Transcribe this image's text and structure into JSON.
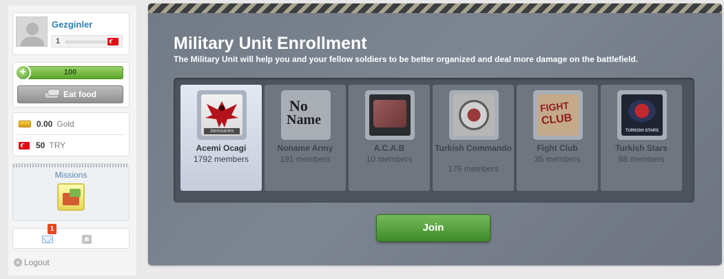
{
  "sidebar": {
    "username": "Gezginler",
    "level": "1",
    "health_value": "100",
    "eat_food_label": "Eat food",
    "gold_amount": "0.00",
    "gold_label": "Gold",
    "try_amount": "50",
    "try_label": "TRY",
    "missions_label": "Missions",
    "messages_badge": "1",
    "logout_label": "Logout"
  },
  "main": {
    "title": "Military Unit Enrollment",
    "subtitle": "The Military Unit will help you and your fellow soldiers to be better organized and deal more damage on the battlefield.",
    "units": [
      {
        "name": "Acemi Ocagi",
        "members": "1792 members",
        "selected": true
      },
      {
        "name": "Noname Army",
        "members": "191 members",
        "selected": false
      },
      {
        "name": "A.C.A.B",
        "members": "10 members",
        "selected": false
      },
      {
        "name": "Turkish Commando",
        "members": "176 members",
        "selected": false
      },
      {
        "name": "Fight Club",
        "members": "35 members",
        "selected": false
      },
      {
        "name": "Turkish Stars",
        "members": "68 members",
        "selected": false
      }
    ],
    "logo_text": {
      "acemi": "Janissaries",
      "noname_1": "No",
      "noname_2": "Name",
      "fightclub_1": "FIGHT",
      "fightclub_2": "CLUB",
      "stars": "TURKISH STARS"
    },
    "join_label": "Join"
  }
}
